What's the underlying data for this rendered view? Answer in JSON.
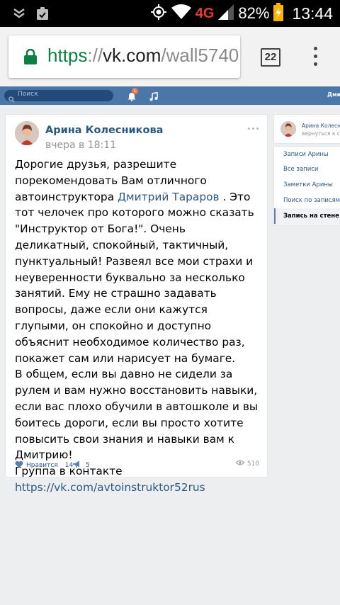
{
  "status_bar": {
    "network": "4G",
    "battery": "82%",
    "time": "13:44"
  },
  "browser": {
    "url_scheme": "https",
    "url_separator": "://",
    "url_host": "vk.com",
    "url_path": "/wall5740",
    "tab_count": "22"
  },
  "vk_header": {
    "search_placeholder": "Поиск",
    "notifications_count": "1",
    "user_name": "Дмит"
  },
  "post": {
    "author": "Арина Колесникова",
    "date": "вчера в 18:11",
    "text_before_link": "Дорогие друзья, разрешите порекомендовать Вам отличного автоинструктора ",
    "mention": "Дмитрий Тараров",
    "text_after_link": " . Это тот челочек про которого можно сказать \"Инструктор от Бога!\". Очень деликатный, спокойный, тактичный, пунктуальный! Развеял все мои страхи и неуверенности буквально за несколько занятий. Ему не страшно задавать вопросы, даже если они кажутся глупыми, он спокойно и доступно объяснит необходимое количество раз, покажет сам или нарисует на бумаге.",
    "paragraph2": "В общем, если вы давно не сидели за рулем и вам нужно восстановить навыки, если вас плохо обучили в автошколе и вы боитесь дороги, если вы просто хотите повысить свои знания и навыки вам к Дмитрию!",
    "group_label": "Группа в контакте",
    "group_link": "https://vk.com/avtoinstruktor52rus",
    "like_label": "Нравится",
    "like_count": "14",
    "share_count": "5",
    "views": "510"
  },
  "sidebar": {
    "profile_name": "Арина Колесн",
    "back_label": "вернуться к с",
    "items": [
      {
        "label": "Записи Арины"
      },
      {
        "label": "Все записи"
      },
      {
        "label": "Заметки Арины"
      },
      {
        "label": "Поиск по записям"
      },
      {
        "label": "Запись на стене"
      }
    ]
  },
  "colors": {
    "vk_blue": "#4a76a8",
    "link": "#2a5885",
    "secure_green": "#0b8043"
  }
}
